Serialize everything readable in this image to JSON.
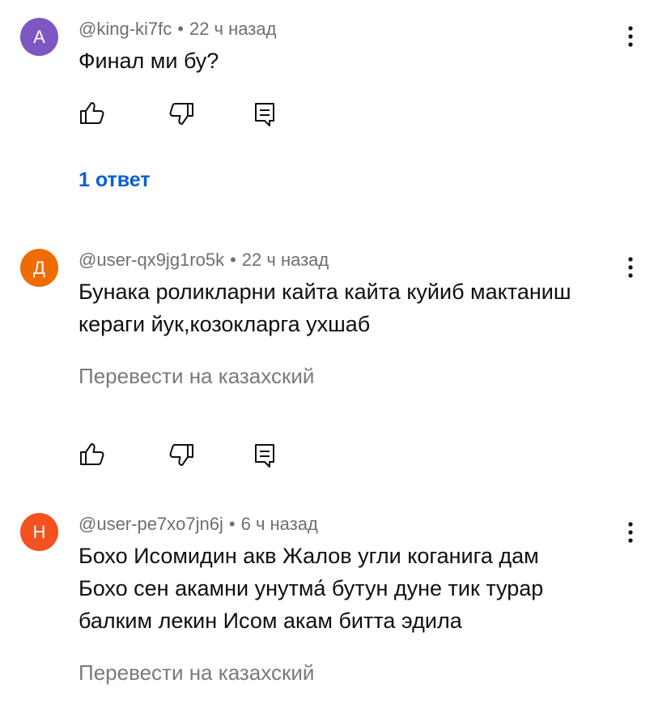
{
  "comments": [
    {
      "avatar_letter": "A",
      "avatar_color": "#7e57c2",
      "author": "@king-ki7fc",
      "time": "22 ч назад",
      "lines": [
        "Финал ми бу?"
      ],
      "replies_label": "1 ответ"
    },
    {
      "avatar_letter": "Д",
      "avatar_color": "#ef6c00",
      "author": "@user-qx9jg1ro5k",
      "time": "22 ч назад",
      "lines": [
        "Бунака роликларни кайта кайта куйиб мактаниш",
        "кераги йук,козокларга ухшаб"
      ],
      "translate_label": "Перевести на казахский"
    },
    {
      "avatar_letter": "Н",
      "avatar_color": "#f4511e",
      "author": "@user-pe7xo7jn6j",
      "time": "6 ч назад",
      "lines": [
        "Бохо Исомидин акв Жалов угли коганига дам",
        "Бохо сен акамни унутма́ бутун дуне тик турар",
        "балким лекин Исом акам битта эдила"
      ],
      "translate_label": "Перевести на казахский"
    }
  ],
  "meta_separator": "•",
  "icons": {
    "like": "thumb-up-icon",
    "dislike": "thumb-down-icon",
    "reply": "reply-icon",
    "more": "more-vert-icon"
  },
  "colors": {
    "link": "#065fd4",
    "meta": "#6f6f6f",
    "text": "#0f0f0f"
  }
}
